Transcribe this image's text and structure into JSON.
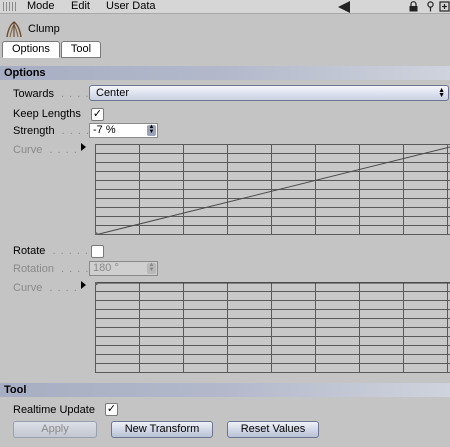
{
  "menubar": {
    "items": [
      "Mode",
      "Edit",
      "User Data"
    ]
  },
  "header": {
    "title": "Clump",
    "icon": "clump-tool-icon"
  },
  "tabs": [
    {
      "label": "Options",
      "active": true
    },
    {
      "label": "Tool",
      "active": false
    }
  ],
  "options": {
    "section_title": "Options",
    "towards": {
      "label": "Towards",
      "value": "Center"
    },
    "keep_lengths": {
      "label": "Keep Lengths",
      "checked": true
    },
    "strength": {
      "label": "Strength",
      "value": "-7 %"
    },
    "curve1": {
      "label": "Curve"
    },
    "rotate": {
      "label": "Rotate",
      "checked": false
    },
    "rotation": {
      "label": "Rotation",
      "value": "180 °",
      "enabled": false
    },
    "curve2": {
      "label": "Curve"
    }
  },
  "tool": {
    "section_title": "Tool",
    "realtime_update": {
      "label": "Realtime Update",
      "checked": true
    },
    "buttons": {
      "apply": "Apply",
      "new_transform": "New Transform",
      "reset_values": "Reset Values"
    }
  },
  "colors": {
    "section_bar": "#aeb4c8",
    "background": "#c4c4c4",
    "grid_line": "#5a5a5a"
  }
}
